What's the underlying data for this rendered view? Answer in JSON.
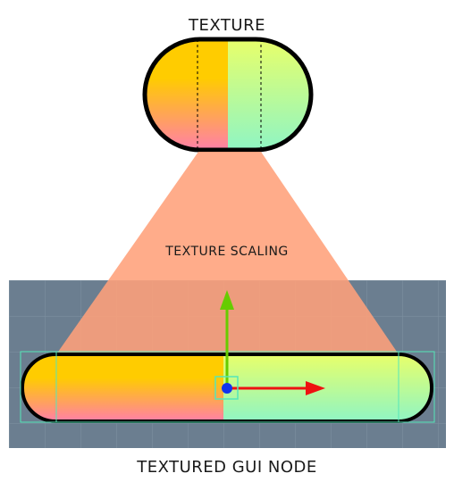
{
  "labels": {
    "texture": "TEXTURE",
    "scaling": "TEXTURE SCALING",
    "node": "TEXTURED GUI NODE"
  },
  "colors": {
    "background": "#ffffff",
    "editor_grid_bg": "#6b7e90",
    "editor_grid_line": "#7f91a2",
    "scaling_beam": "#ffa07a",
    "outline": "#000000",
    "warm_top": "#ffcc00",
    "warm_bottom": "#ff7fa8",
    "cool_top": "#e8ff6a",
    "cool_bottom": "#8ff5c4",
    "bounds": "#55e6b8",
    "axis_x": "#ee1111",
    "axis_y": "#66cc00",
    "pivot": "#1133ee"
  },
  "icons": [
    "pivot-handle-icon",
    "x-axis-arrow-icon",
    "y-axis-arrow-icon"
  ]
}
